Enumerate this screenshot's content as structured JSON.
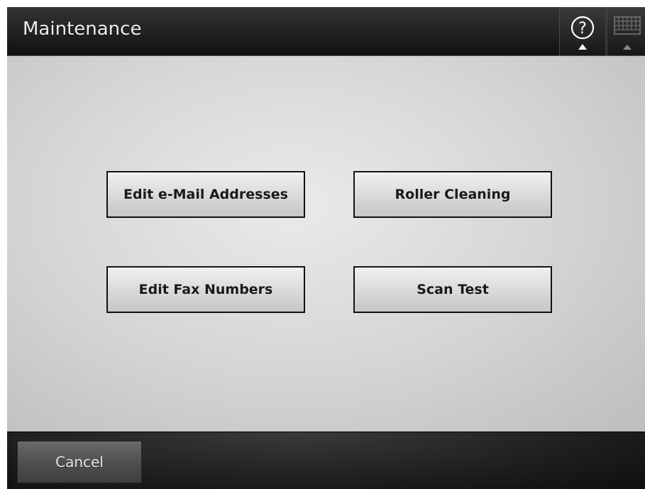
{
  "header": {
    "title": "Maintenance",
    "help_icon": "help-icon",
    "keyboard_icon": "keyboard-icon"
  },
  "actions": {
    "edit_email_label": "Edit e-Mail Addresses",
    "roller_cleaning_label": "Roller Cleaning",
    "edit_fax_label": "Edit Fax Numbers",
    "scan_test_label": "Scan Test"
  },
  "footer": {
    "cancel_label": "Cancel"
  }
}
